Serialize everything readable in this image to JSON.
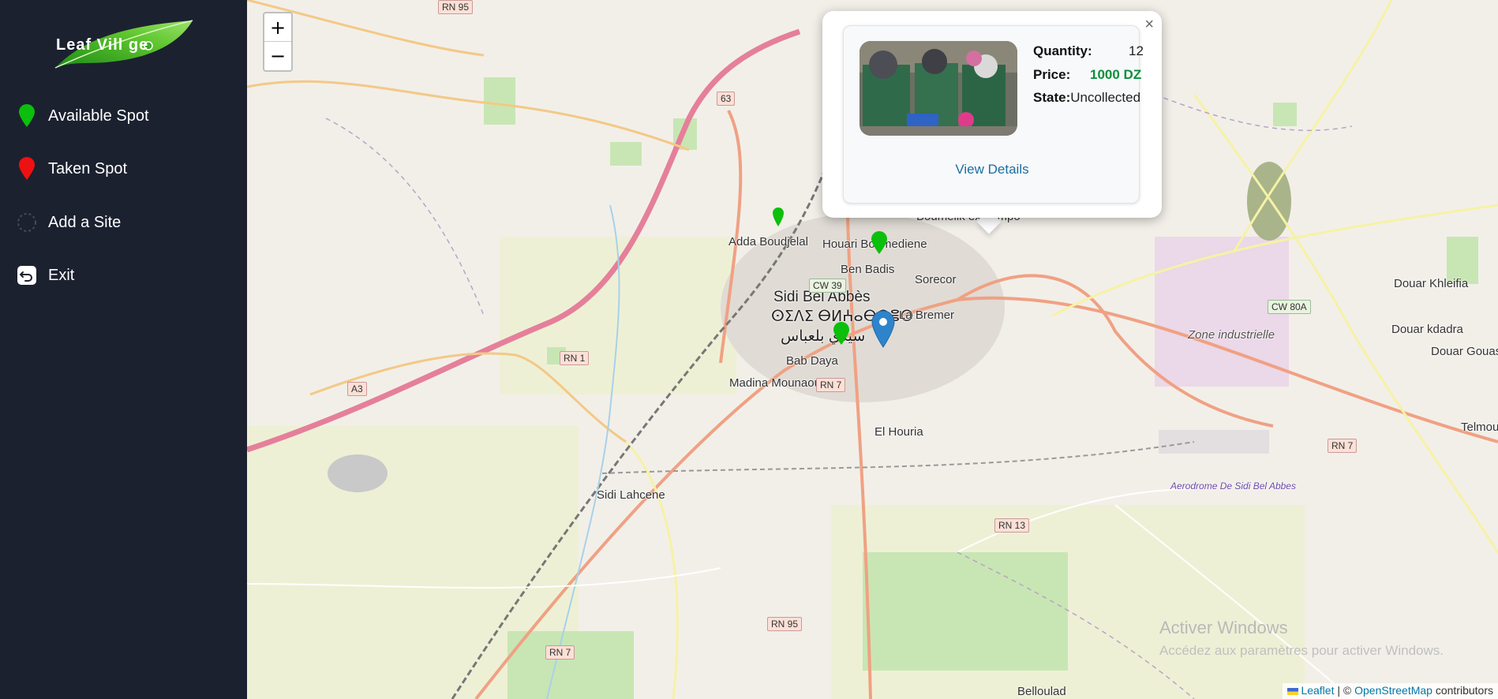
{
  "sidebar": {
    "logo_text": "Leaf Vill  ge",
    "items": [
      {
        "label": "Available Spot",
        "icon": "green-pin-icon",
        "color": "#0cbf0c"
      },
      {
        "label": "Taken Spot",
        "icon": "red-pin-icon",
        "color": "#ee1111"
      },
      {
        "label": "Add a Site",
        "icon": "dashed-circle-icon"
      },
      {
        "label": "Exit",
        "icon": "exit-icon"
      }
    ]
  },
  "map": {
    "zoom_in": "+",
    "zoom_out": "−",
    "places": {
      "sidi_bel_abbes": "Sidi Bel Abbès",
      "sidi_bel_abbes_tif": "ⵙⵉⴷⵉ ⴱⵍⵄⴰⴱⴱⴻⵙ",
      "sidi_bel_abbes_ar": "سيدي بلعباس",
      "adda_boudjelal": "Adda Boudjelal",
      "houari_boumediene": "Houari Boumediene",
      "ben_badis": "Ben Badis",
      "sorecor": "Sorecor",
      "la_bremer": "La Bremer",
      "bab_daya": "Bab Daya",
      "madina_mounaouara": "Madina Mounaouara",
      "el_houria": "El Houria",
      "sidi_lahcene": "Sidi Lahcene",
      "zone_industrielle": "Zone industrielle",
      "douar_khleifia": "Douar Khleifia",
      "douar_kdadra": "Douar kdadra",
      "douar_gouas": "Douar Gouas",
      "telmoun": "Telmoun",
      "boumelik": "Boumelik ex-campo",
      "belloulad": "Belloulad",
      "aerodrome": "Aerodrome De Sidi Bel Abbes"
    },
    "roads": [
      "RN 95",
      "RN 1",
      "RN 7",
      "RN 13",
      "CW 39",
      "CW 80A",
      "A3",
      "RN 95",
      "RN 7",
      "RN 7",
      "63"
    ],
    "popup": {
      "quantity_label": "Quantity:",
      "quantity_value": "12",
      "price_label": "Price:",
      "price_value": "1000 DZ",
      "price_color": "#0a8f3c",
      "state_label": "State:",
      "state_value": "Uncollected",
      "view_details": "View Details",
      "close": "×"
    },
    "watermark_title": "Activer Windows",
    "watermark_sub": "Accédez aux paramètres pour activer Windows.",
    "attribution": {
      "leaflet": "Leaflet",
      "sep": " | © ",
      "osm": "OpenStreetMap",
      "contrib": " contributors"
    }
  }
}
